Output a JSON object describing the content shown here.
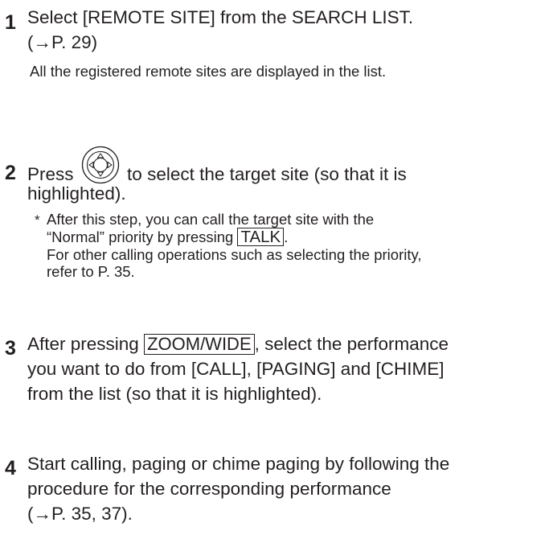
{
  "steps": [
    {
      "number": "1",
      "line1": "Select [REMOTE SITE] from the SEARCH LIST.",
      "line2": "(→P. 29)",
      "sub": "All the registered remote sites are displayed in the list."
    },
    {
      "number": "2",
      "text_before_icon": "Press",
      "icon": "joystick-icon",
      "text_after_icon": "to select the target site (so that it is",
      "line2": "highlighted).",
      "note_marker": "*",
      "note_line1": "After this step, you can call the target site with the",
      "note_line2_before_key": "“Normal” priority by pressing",
      "note_key": "TALK",
      "note_line2_after_key": ".",
      "note_line3": "For other calling operations such as selecting the priority,",
      "note_line4": "refer to P. 35."
    },
    {
      "number": "3",
      "line1_before_key": "After pressing",
      "key": "ZOOM/WIDE",
      "line1_after_key": ", select the performance",
      "line2": "you want to do from [CALL], [PAGING] and [CHIME]",
      "line3": "from the list (so that it is highlighted)."
    },
    {
      "number": "4",
      "line1": "Start calling, paging or chime paging by following the",
      "line2": "procedure for the corresponding performance",
      "line3": "(→P. 35, 37)."
    }
  ]
}
